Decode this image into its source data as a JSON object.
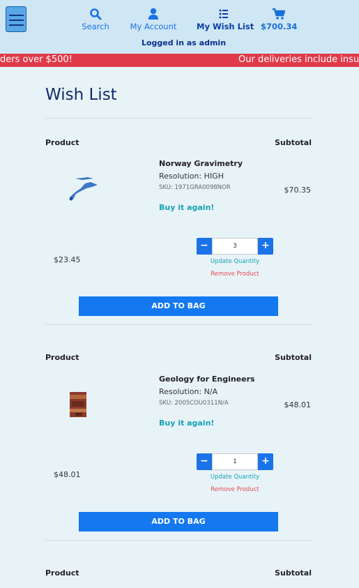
{
  "nav": {
    "search": "Search",
    "account": "My Account",
    "wishlist": "My Wish List",
    "cart_total": "$700.34"
  },
  "logged_in": "Logged in as admin",
  "banner": {
    "left": "ders over $500!",
    "right": "Our deliveries include insu"
  },
  "page_title": "Wish List",
  "columns": {
    "product": "Product",
    "subtotal": "Subtotal"
  },
  "items": [
    {
      "name": "Norway Gravimetry",
      "resolution": "Resolution: HIGH",
      "sku": "SKU: 1971GRA0098NOR",
      "buy_again": "Buy it again!",
      "subtotal": "$70.35",
      "price": "$23.45",
      "quantity": "3",
      "update": "Update Quantity",
      "remove": "Remove Product",
      "add_to_bag": "ADD TO BAG"
    },
    {
      "name": "Geology for Engineers",
      "resolution": "Resolution: N/A",
      "sku": "SKU: 2005COU0311N/A",
      "buy_again": "Buy it again!",
      "subtotal": "$48.01",
      "price": "$48.01",
      "quantity": "1",
      "update": "Update Quantity",
      "remove": "Remove Product",
      "add_to_bag": "ADD TO BAG"
    }
  ],
  "third_row": {
    "product": "Product",
    "subtotal": "Subtotal"
  },
  "colors": {
    "header_bg": "#cfe6f4",
    "banner_bg": "#e03a4a",
    "accent": "#1a73e8",
    "buy_again": "#16a3b8",
    "remove": "#e04a4a"
  },
  "icons": [
    "menu-icon",
    "search-icon",
    "user-icon",
    "list-icon",
    "cart-icon",
    "minus-icon",
    "plus-icon"
  ]
}
